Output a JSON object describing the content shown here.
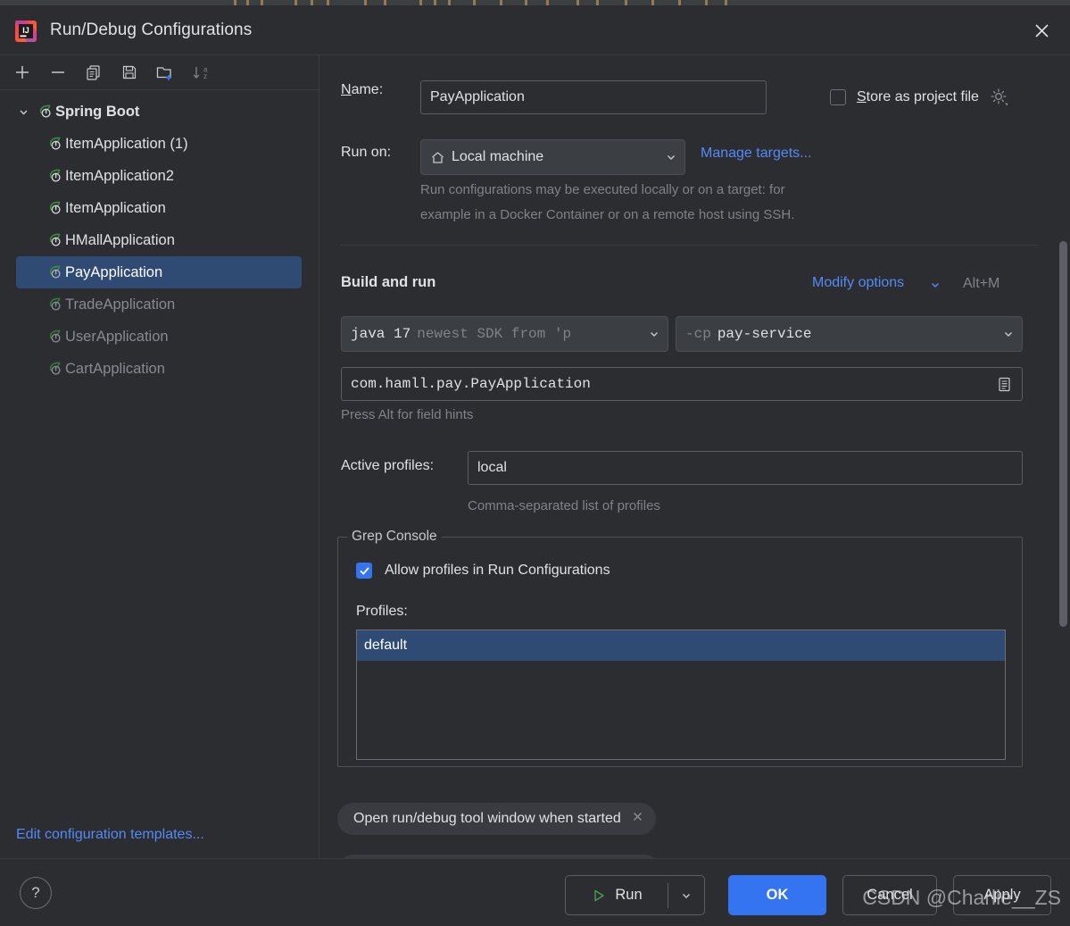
{
  "window": {
    "title": "Run/Debug Configurations",
    "logo_icon": "intellij-idea-logo",
    "close_icon": "close-icon"
  },
  "toolbar": {
    "buttons": [
      {
        "name": "add-configuration-button",
        "icon": "plus-icon"
      },
      {
        "name": "remove-configuration-button",
        "icon": "minus-icon"
      },
      {
        "name": "copy-configuration-button",
        "icon": "copy-icon"
      },
      {
        "name": "save-configuration-button",
        "icon": "save-icon"
      },
      {
        "name": "new-folder-button",
        "icon": "new-folder-icon"
      },
      {
        "name": "sort-configurations-button",
        "icon": "sort-alpha-icon"
      }
    ]
  },
  "sidebar": {
    "root": {
      "label": "Spring Boot",
      "icon": "spring-boot-icon",
      "expanded": true
    },
    "items": [
      {
        "label": "ItemApplication (1)",
        "icon": "spring-boot-icon",
        "selected": false,
        "dim": false
      },
      {
        "label": "ItemApplication2",
        "icon": "spring-boot-icon",
        "selected": false,
        "dim": false
      },
      {
        "label": "ItemApplication",
        "icon": "spring-boot-icon",
        "selected": false,
        "dim": false
      },
      {
        "label": "HMallApplication",
        "icon": "spring-boot-icon",
        "selected": false,
        "dim": false
      },
      {
        "label": "PayApplication",
        "icon": "spring-boot-icon",
        "selected": true,
        "dim": false
      },
      {
        "label": "TradeApplication",
        "icon": "spring-boot-icon",
        "selected": false,
        "dim": true
      },
      {
        "label": "UserApplication",
        "icon": "spring-boot-icon",
        "selected": false,
        "dim": true
      },
      {
        "label": "CartApplication",
        "icon": "spring-boot-icon",
        "selected": false,
        "dim": true
      }
    ],
    "edit_templates_link": "Edit configuration templates..."
  },
  "form": {
    "name_label": "Name:",
    "name_value": "PayApplication",
    "store_as_project_file_label": "Store as project file",
    "store_as_project_file_checked": false,
    "store_gear_icon": "gear-icon",
    "run_on_label": "Run on:",
    "run_on_value": "Local machine",
    "run_on_icon": "home-icon",
    "manage_targets_link": "Manage targets...",
    "run_on_hint_line1": "Run configurations may be executed locally or on a target: for",
    "run_on_hint_line2": "example in a Docker Container or on a remote host using SSH.",
    "build_and_run_title": "Build and run",
    "modify_options_link": "Modify options",
    "modify_options_shortcut": "Alt+M",
    "jre_value": "java 17",
    "jre_hint": "newest SDK from 'p",
    "cp_prefix": "-cp",
    "cp_value": "pay-service",
    "main_class_value": "com.hamll.pay.PayApplication",
    "main_class_browse_icon": "class-chooser-icon",
    "field_hints_text": "Press Alt for field hints",
    "active_profiles_label": "Active profiles:",
    "active_profiles_value": "local",
    "active_profiles_hint": "Comma-separated list of profiles"
  },
  "grep_console": {
    "group_title": "Grep Console",
    "allow_profiles_label": "Allow profiles in Run Configurations",
    "allow_profiles_checked": true,
    "profiles_label": "Profiles:",
    "profiles": [
      {
        "label": "default",
        "selected": true
      }
    ]
  },
  "chips": [
    {
      "label": "Open run/debug tool window when started",
      "close_icon": "chip-close-icon"
    }
  ],
  "footer": {
    "help_label": "?",
    "run_label": "Run",
    "run_icon": "run-triangle-icon",
    "run_dropdown_icon": "chevron-down-icon",
    "ok_label": "OK",
    "cancel_label": "Cancel",
    "apply_label": "Apply"
  },
  "watermark": "CSDN @Charlie__ZS",
  "colors": {
    "background": "#2b2d30",
    "selection": "#2f4a73",
    "accent_blue": "#3574f0",
    "link_blue": "#548af7",
    "spring_green": "#3d8b40",
    "muted_text": "#7f8289",
    "border": "#4e5157"
  }
}
